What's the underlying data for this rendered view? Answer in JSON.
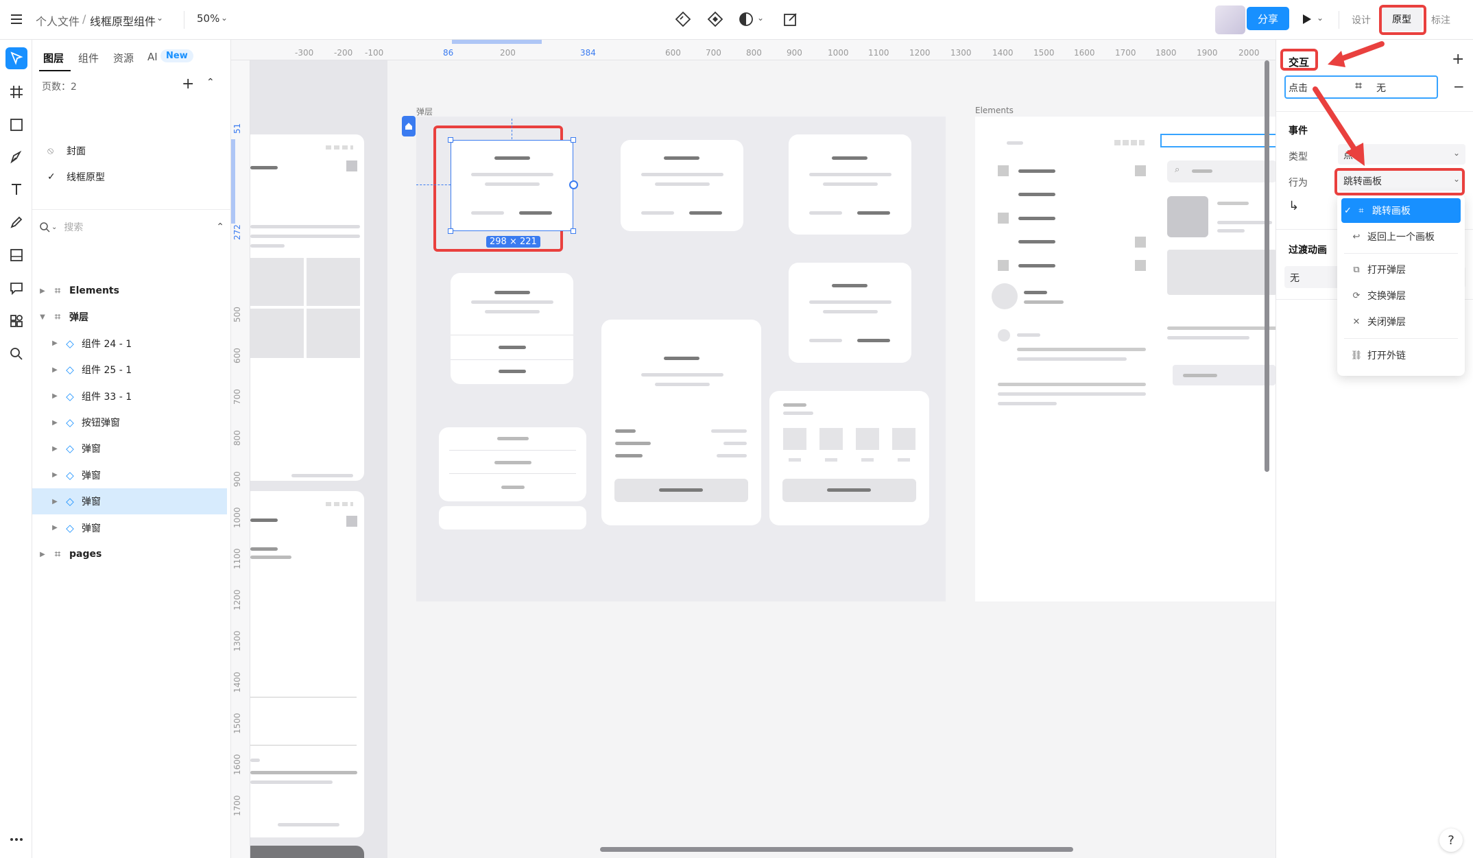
{
  "topbar": {
    "breadcrumb_parent": "个人文件",
    "breadcrumb_sep": "/",
    "file_name": "线框原型组件",
    "zoom": "50%",
    "share_label": "分享",
    "mode_design": "设计",
    "mode_prototype": "原型",
    "mode_annotate": "标注"
  },
  "layers_panel": {
    "tabs": [
      "图层",
      "组件",
      "资源",
      "AI"
    ],
    "new_badge": "New",
    "pages_label": "页数：2",
    "pages": [
      {
        "name": "封面",
        "icon": "ban-icon"
      },
      {
        "name": "线框原型",
        "icon": "check-icon"
      }
    ],
    "search_placeholder": "搜索",
    "layers": [
      {
        "name": "Elements",
        "type": "frame",
        "depth": 0
      },
      {
        "name": "弹层",
        "type": "frame",
        "depth": 0,
        "expanded": true
      },
      {
        "name": "组件 24 - 1",
        "type": "component",
        "depth": 1
      },
      {
        "name": "组件 25 - 1",
        "type": "component",
        "depth": 1
      },
      {
        "name": "组件 33 - 1",
        "type": "component",
        "depth": 1
      },
      {
        "name": "按钮弹窗",
        "type": "component",
        "depth": 1
      },
      {
        "name": "弹窗",
        "type": "component",
        "depth": 1
      },
      {
        "name": "弹窗",
        "type": "component",
        "depth": 1
      },
      {
        "name": "弹窗",
        "type": "component",
        "depth": 1,
        "selected": true
      },
      {
        "name": "弹窗",
        "type": "component",
        "depth": 1
      },
      {
        "name": "pages",
        "type": "frame",
        "depth": 0
      }
    ]
  },
  "ruler": {
    "h_ticks": [
      "-300",
      "-200",
      "-100",
      "86",
      "200",
      "384",
      "600",
      "700",
      "800",
      "900",
      "1000",
      "1100",
      "1200",
      "1300",
      "1400",
      "1500",
      "1600",
      "1700",
      "1800",
      "1900",
      "2000"
    ],
    "v_ticks": [
      "51",
      "272",
      "500",
      "600",
      "700",
      "800",
      "900",
      "1000",
      "1100",
      "1200",
      "1300",
      "1400",
      "1500",
      "1600",
      "1700"
    ]
  },
  "canvas": {
    "frame_label_popup": "弹层",
    "frame_label_elements": "Elements",
    "selection_size": "298 × 221"
  },
  "right_panel": {
    "section_title": "交互",
    "trigger_label": "点击",
    "target_label": "无",
    "event_title": "事件",
    "type_label": "类型",
    "type_value": "点击",
    "action_label": "行为",
    "action_value": "跳转画板",
    "transition_title": "过渡动画",
    "transition_value": "无"
  },
  "action_menu": {
    "items": [
      {
        "label": "跳转画板",
        "icon": "frame-icon",
        "selected": true
      },
      {
        "label": "返回上一个画板",
        "icon": "back-icon"
      },
      {
        "label": "打开弹层",
        "icon": "open-layer-icon"
      },
      {
        "label": "交换弹层",
        "icon": "swap-icon"
      },
      {
        "label": "关闭弹层",
        "icon": "close-icon"
      },
      {
        "label": "打开外链",
        "icon": "link-icon"
      }
    ]
  },
  "colors": {
    "accent": "#1890ff",
    "annotation_red": "#e9403e",
    "selection_blue": "#3a7bf0"
  }
}
